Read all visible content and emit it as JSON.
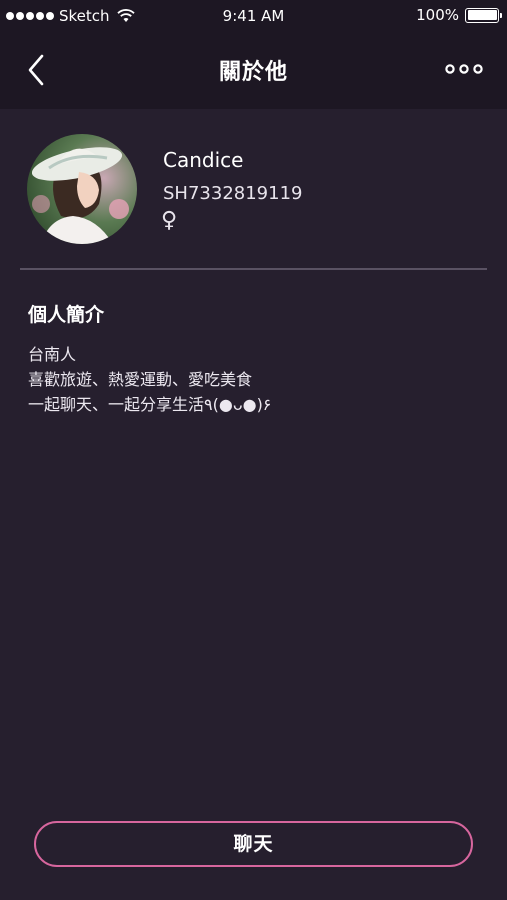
{
  "status_bar": {
    "carrier": "Sketch",
    "time": "9:41 AM",
    "battery": "100%",
    "battery_level": 1.0
  },
  "nav": {
    "title": "關於他",
    "back_icon": "chevron-left-icon",
    "more_icon": "more-horizontal-icon"
  },
  "profile": {
    "name": "Candice",
    "id": "SH7332819119",
    "gender_symbol": "♀"
  },
  "about": {
    "title": "個人簡介",
    "lines": [
      "台南人",
      "喜歡旅遊、熱愛運動、愛吃美食",
      "一起聊天、一起分享生活٩(●ᴗ●)۶"
    ]
  },
  "actions": {
    "chat_label": "聊天"
  },
  "colors": {
    "background": "#261f2e",
    "header": "#1d1723",
    "accent": "#d7669e",
    "divider": "#5a5263"
  }
}
